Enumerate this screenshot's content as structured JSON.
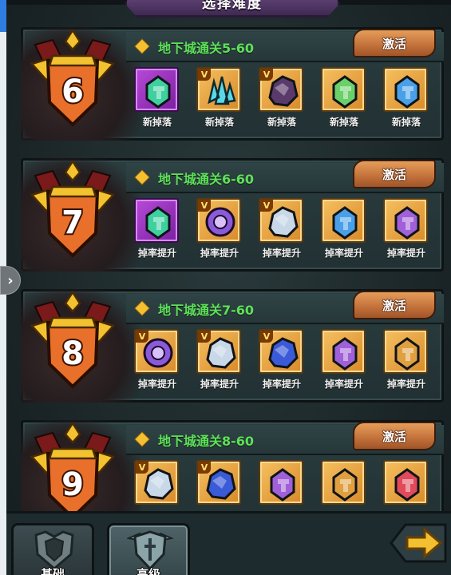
{
  "header": {
    "title": "选择难度"
  },
  "activate_label": "激活",
  "rows": [
    {
      "level": "6",
      "stage": "地下城通关5-60",
      "items": [
        {
          "label": "新掉落",
          "rarity": "purple",
          "vbadge": "",
          "icon": "green-rune-stone-icon",
          "color": "#3fd0a0"
        },
        {
          "label": "新掉落",
          "rarity": "orange",
          "vbadge": "V",
          "icon": "cyan-crystal-icon",
          "color": "#5ad8e8"
        },
        {
          "label": "新掉落",
          "rarity": "orange",
          "vbadge": "V",
          "icon": "dark-ore-icon",
          "color": "#5a3a6a"
        },
        {
          "label": "新掉落",
          "rarity": "orange",
          "vbadge": "",
          "icon": "green-rune-stone-icon",
          "color": "#6ad06a"
        },
        {
          "label": "新掉落",
          "rarity": "orange",
          "vbadge": "",
          "icon": "blue-rune-stone-icon",
          "color": "#4aa0e8"
        }
      ]
    },
    {
      "level": "7",
      "stage": "地下城通关6-60",
      "items": [
        {
          "label": "掉率提升",
          "rarity": "purple",
          "vbadge": "",
          "icon": "green-rune-stone-icon",
          "color": "#3fd0a0"
        },
        {
          "label": "掉率提升",
          "rarity": "orange",
          "vbadge": "V",
          "icon": "purple-orb-icon",
          "color": "#8a5ad8"
        },
        {
          "label": "掉率提升",
          "rarity": "orange",
          "vbadge": "V",
          "icon": "silver-ore-icon",
          "color": "#c8d8e8"
        },
        {
          "label": "掉率提升",
          "rarity": "orange",
          "vbadge": "",
          "icon": "blue-rune-stone-icon",
          "color": "#4aa0e8"
        },
        {
          "label": "掉率提升",
          "rarity": "orange",
          "vbadge": "",
          "icon": "purple-rune-stone-icon",
          "color": "#a060d8"
        }
      ]
    },
    {
      "level": "8",
      "stage": "地下城通关7-60",
      "items": [
        {
          "label": "掉率提升",
          "rarity": "orange",
          "vbadge": "V",
          "icon": "purple-orb-icon",
          "color": "#8a5ad8"
        },
        {
          "label": "掉率提升",
          "rarity": "orange",
          "vbadge": "V",
          "icon": "silver-ore-icon",
          "color": "#c8d8e8"
        },
        {
          "label": "掉率提升",
          "rarity": "orange",
          "vbadge": "V",
          "icon": "blue-ore-icon",
          "color": "#3a5ad8"
        },
        {
          "label": "掉率提升",
          "rarity": "orange",
          "vbadge": "",
          "icon": "purple-rune-stone-icon",
          "color": "#a060d8"
        },
        {
          "label": "掉率提升",
          "rarity": "orange",
          "vbadge": "",
          "icon": "gold-rune-stone-icon",
          "color": "#e0a040"
        }
      ]
    },
    {
      "level": "9",
      "stage": "地下城通关8-60",
      "items": [
        {
          "label": "",
          "rarity": "orange",
          "vbadge": "V",
          "icon": "silver-ore-icon",
          "color": "#c8d8e8"
        },
        {
          "label": "",
          "rarity": "orange",
          "vbadge": "V",
          "icon": "blue-ore-icon",
          "color": "#3a5ad8"
        },
        {
          "label": "",
          "rarity": "orange",
          "vbadge": "",
          "icon": "purple-rune-stone-icon",
          "color": "#a060d8"
        },
        {
          "label": "",
          "rarity": "orange",
          "vbadge": "",
          "icon": "gold-rune-stone-icon",
          "color": "#e0a040"
        },
        {
          "label": "",
          "rarity": "orange",
          "vbadge": "",
          "icon": "red-rune-stone-icon",
          "color": "#e04a5a"
        }
      ]
    }
  ],
  "tabs": {
    "basic": "基础",
    "advanced": "高级"
  },
  "colors": {
    "stage_text": "#5ee05a",
    "button": "#c2703a",
    "crest_gold": "#f2c230",
    "crest_shield": "#e8702a"
  }
}
